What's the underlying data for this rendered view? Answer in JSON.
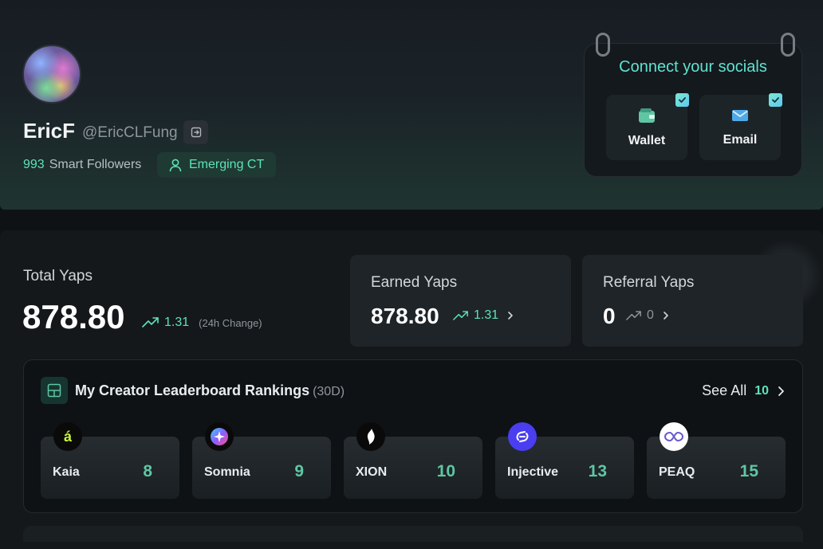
{
  "profile": {
    "name": "EricF",
    "handle": "@EricCLFung",
    "smart_followers_count": "993",
    "smart_followers_label": "Smart Followers",
    "badge": "Emerging CT"
  },
  "socials": {
    "title": "Connect your socials",
    "items": [
      {
        "label": "Wallet",
        "icon": "wallet-icon"
      },
      {
        "label": "Email",
        "icon": "mail-icon"
      }
    ]
  },
  "totals": {
    "label": "Total Yaps",
    "value": "878.80",
    "change": "1.31",
    "change_hint": "(24h Change)"
  },
  "earned": {
    "label": "Earned Yaps",
    "value": "878.80",
    "change": "1.31"
  },
  "referral": {
    "label": "Referral Yaps",
    "value": "0",
    "change": "0"
  },
  "leaderboard": {
    "title": "My Creator Leaderboard Rankings",
    "period": "(30D)",
    "see_all": "See All",
    "count": "10",
    "items": [
      {
        "name": "Kaia",
        "rank": "8",
        "logo_char": "á"
      },
      {
        "name": "Somnia",
        "rank": "9",
        "logo_char": ""
      },
      {
        "name": "XION",
        "rank": "10",
        "logo_char": ""
      },
      {
        "name": "Injective",
        "rank": "13",
        "logo_char": ""
      },
      {
        "name": "PEAQ",
        "rank": "15",
        "logo_char": ""
      }
    ]
  },
  "colors": {
    "accent": "#5fe3b5",
    "rank": "#5fc6a3",
    "socials_title": "#5fe3d0"
  }
}
